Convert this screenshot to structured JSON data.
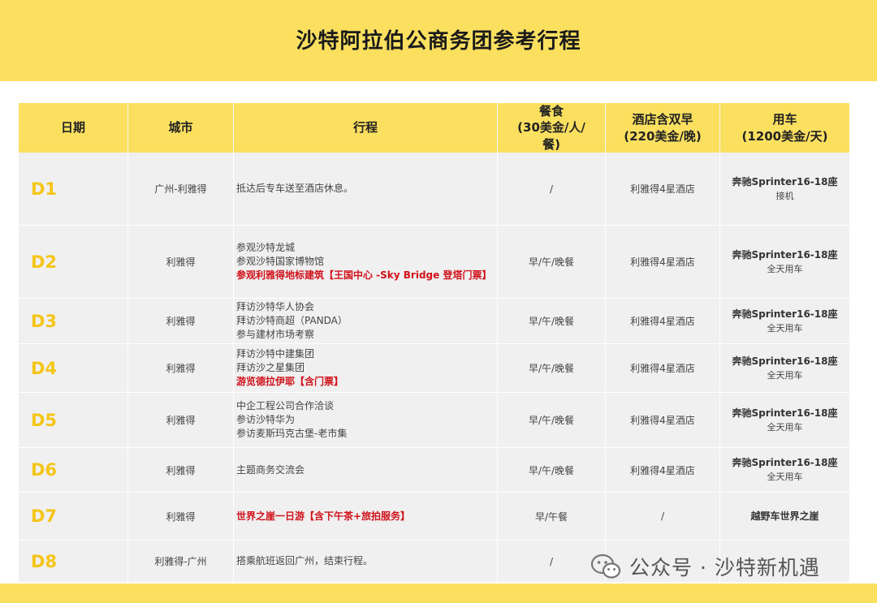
{
  "title": "沙特阿拉伯公商务团参考行程",
  "headers": {
    "day": "日期",
    "city": "城市",
    "itinerary": "行程",
    "meal": [
      "餐食",
      "(30美金/人/",
      "餐)"
    ],
    "hotel": [
      "酒店含双早",
      "(220美金/晚)"
    ],
    "car": [
      "用车",
      "(1200美金/天)"
    ]
  },
  "rows": [
    {
      "day": "D1",
      "city": "广州-利雅得",
      "itinerary": [
        {
          "text": "抵达后专车送至酒店休息。",
          "highlight": false
        }
      ],
      "meal": "/",
      "hotel": "利雅得4星酒店",
      "car_main": "奔驰Sprinter16-18座",
      "car_sub": "接机"
    },
    {
      "day": "D2",
      "city": "利雅得",
      "itinerary": [
        {
          "text": "参观沙特龙城",
          "highlight": false
        },
        {
          "text": "参观沙特国家博物馆",
          "highlight": false
        },
        {
          "text": "参观利雅得地标建筑【王国中心 -Sky Bridge 登塔门票】",
          "highlight": true
        }
      ],
      "meal": "早/午/晚餐",
      "hotel": "利雅得4星酒店",
      "car_main": "奔驰Sprinter16-18座",
      "car_sub": "全天用车"
    },
    {
      "day": "D3",
      "city": "利雅得",
      "itinerary": [
        {
          "text": "拜访沙特华人协会",
          "highlight": false
        },
        {
          "text": "拜访沙特商超（PANDA）",
          "highlight": false
        },
        {
          "text": "参与建材市场考察",
          "highlight": false
        }
      ],
      "meal": "早/午/晚餐",
      "hotel": "利雅得4星酒店",
      "car_main": "奔驰Sprinter16-18座",
      "car_sub": "全天用车"
    },
    {
      "day": "D4",
      "city": "利雅得",
      "itinerary": [
        {
          "text": "拜访沙特中建集团",
          "highlight": false
        },
        {
          "text": "拜访沙之星集团",
          "highlight": false
        },
        {
          "text": "游览德拉伊耶【含门票】",
          "highlight": true
        }
      ],
      "meal": "早/午/晚餐",
      "hotel": "利雅得4星酒店",
      "car_main": "奔驰Sprinter16-18座",
      "car_sub": "全天用车"
    },
    {
      "day": "D5",
      "city": "利雅得",
      "itinerary": [
        {
          "text": "中企工程公司合作洽谈",
          "highlight": false
        },
        {
          "text": "参访沙特华为",
          "highlight": false
        },
        {
          "text": "参访麦斯玛克古堡-老市集",
          "highlight": false
        }
      ],
      "meal": "早/午/晚餐",
      "hotel": "利雅得4星酒店",
      "car_main": "奔驰Sprinter16-18座",
      "car_sub": "全天用车"
    },
    {
      "day": "D6",
      "city": "利雅得",
      "itinerary": [
        {
          "text": " 主题商务交流会",
          "highlight": false
        }
      ],
      "meal": "早/午/晚餐",
      "hotel": "利雅得4星酒店",
      "car_main": "奔驰Sprinter16-18座",
      "car_sub": "全天用车"
    },
    {
      "day": "D7",
      "city": "利雅得",
      "itinerary": [
        {
          "text": "世界之崖一日游【含下午茶+旅拍服务】",
          "highlight": true
        }
      ],
      "meal": "早/午餐",
      "hotel": "/",
      "car_main": "越野车世界之崖",
      "car_sub": ""
    },
    {
      "day": "D8",
      "city": "利雅得-广州",
      "itinerary": [
        {
          "text": "搭乘航班返回广州，结束行程。",
          "highlight": false
        }
      ],
      "meal": "/",
      "hotel": "",
      "car_main": "",
      "car_sub": ""
    }
  ],
  "watermark": "公众号 · 沙特新机遇",
  "colors": {
    "accent": "#FBE060",
    "day_label": "#F5C518",
    "highlight": "#d0121b",
    "row_bg": "#f0f0f0"
  }
}
